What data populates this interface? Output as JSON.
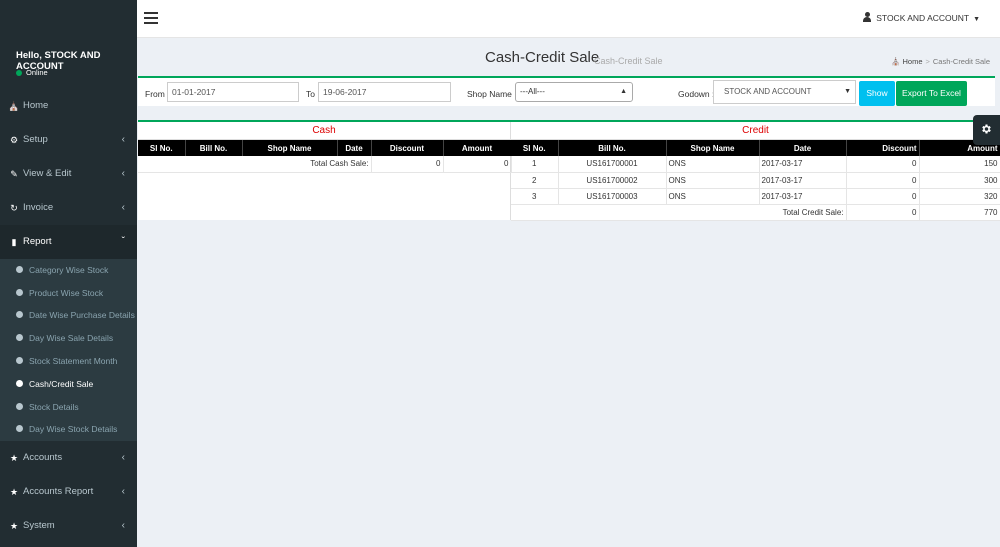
{
  "sidebar": {
    "greeting": "Hello, STOCK AND ACCOUNT",
    "status": "Online",
    "items": [
      {
        "label": "Home"
      },
      {
        "label": "Setup"
      },
      {
        "label": "View & Edit"
      },
      {
        "label": "Invoice"
      },
      {
        "label": "Report"
      },
      {
        "label": "Accounts"
      },
      {
        "label": "Accounts Report"
      },
      {
        "label": "System"
      }
    ],
    "report_submenu": [
      {
        "label": "Category Wise Stock"
      },
      {
        "label": "Product Wise Stock"
      },
      {
        "label": "Date Wise Purchase Details"
      },
      {
        "label": "Day Wise Sale Details"
      },
      {
        "label": "Stock Statement Month"
      },
      {
        "label": "Cash/Credit Sale"
      },
      {
        "label": "Stock Details"
      },
      {
        "label": "Day Wise Stock Details"
      }
    ]
  },
  "header": {
    "user": "STOCK AND ACCOUNT"
  },
  "page": {
    "title": "Cash-Credit Sale",
    "subtitle": "Cash-Credit Sale",
    "breadcrumb": {
      "home": "Home",
      "current": "Cash-Credit Sale"
    }
  },
  "filters": {
    "from_label": "From :",
    "from_value": "01-01-2017",
    "to_label": "To :",
    "to_value": "19-06-2017",
    "shop_label": "Shop Name :",
    "shop_value": "---All---",
    "godown_label": "Godown :",
    "godown_value": "STOCK AND ACCOUNT",
    "show_label": "Show",
    "export_label": "Export To Excel"
  },
  "cash": {
    "title": "Cash",
    "headers": [
      "Sl No.",
      "Bill No.",
      "Shop Name",
      "Date",
      "Discount",
      "Amount"
    ],
    "total_label": "Total Cash Sale:",
    "total_discount": "0",
    "total_amount": "0"
  },
  "credit": {
    "title": "Credit",
    "headers": [
      "Sl No.",
      "Bill No.",
      "Shop Name",
      "Date",
      "Discount",
      "Amount"
    ],
    "rows": [
      {
        "sl": "1",
        "bill": "US161700001",
        "shop": "ONS",
        "date": "2017-03-17",
        "discount": "0",
        "amount": "150"
      },
      {
        "sl": "2",
        "bill": "US161700002",
        "shop": "ONS",
        "date": "2017-03-17",
        "discount": "0",
        "amount": "300"
      },
      {
        "sl": "3",
        "bill": "US161700003",
        "shop": "ONS",
        "date": "2017-03-17",
        "discount": "0",
        "amount": "320"
      }
    ],
    "total_label": "Total Credit Sale:",
    "total_discount": "0",
    "total_amount": "770"
  }
}
